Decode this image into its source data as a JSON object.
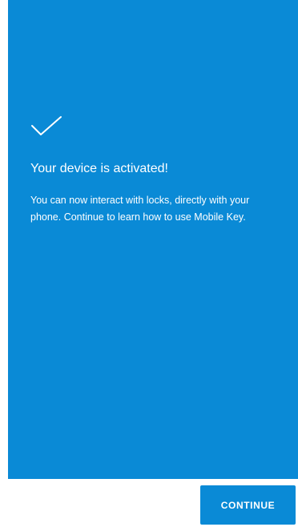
{
  "activation": {
    "title": "Your device is activated!",
    "message": "You can now interact with locks, directly with your phone. Continue to learn how to use Mobile Key.",
    "icon": "checkmark-icon"
  },
  "footer": {
    "continue_label": "CONTINUE"
  },
  "colors": {
    "primary": "#0a8ad6",
    "background": "#ffffff",
    "text_on_primary": "#ffffff"
  }
}
